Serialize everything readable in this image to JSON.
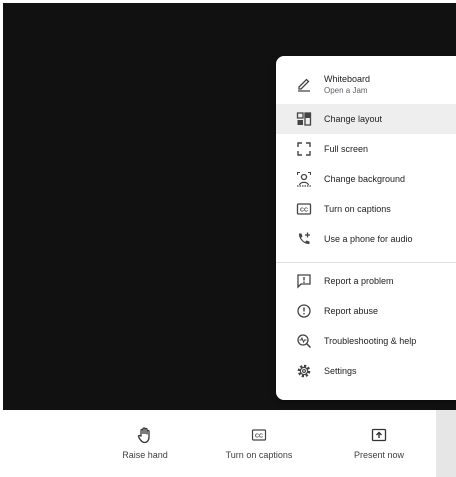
{
  "menu": {
    "items": [
      {
        "label": "Whiteboard",
        "sublabel": "Open a Jam",
        "icon": "pen-icon"
      },
      {
        "label": "Change layout",
        "icon": "layout-icon"
      },
      {
        "label": "Full screen",
        "icon": "fullscreen-icon"
      },
      {
        "label": "Change background",
        "icon": "background-icon"
      },
      {
        "label": "Turn on captions",
        "icon": "captions-icon"
      },
      {
        "label": "Use a phone for audio",
        "icon": "phone-add-icon"
      },
      {
        "label": "Report a problem",
        "icon": "feedback-icon"
      },
      {
        "label": "Report abuse",
        "icon": "alert-circle-icon"
      },
      {
        "label": "Troubleshooting & help",
        "icon": "troubleshoot-icon"
      },
      {
        "label": "Settings",
        "icon": "gear-icon"
      }
    ]
  },
  "controls": {
    "raise_hand": "Raise hand",
    "captions": "Turn on captions",
    "present": "Present now"
  }
}
